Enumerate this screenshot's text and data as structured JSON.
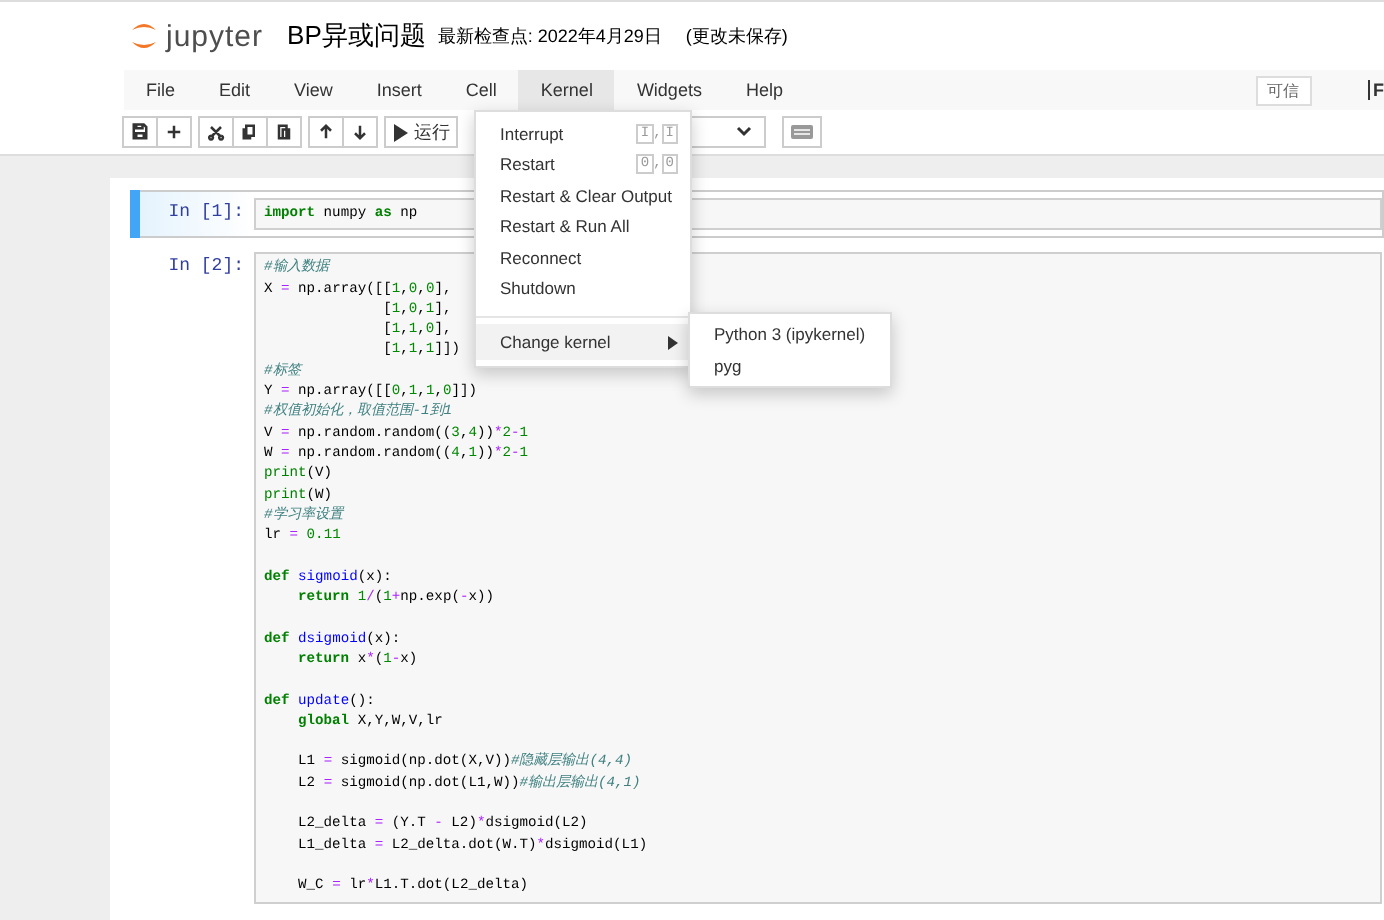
{
  "header": {
    "logo_text": "jupyter",
    "title": "BP异或问题",
    "checkpoint": "最新检查点: 2022年4月29日",
    "unsaved": "(更改未保存)"
  },
  "menubar": {
    "items": [
      {
        "label": "File",
        "selected": false
      },
      {
        "label": "Edit",
        "selected": false
      },
      {
        "label": "View",
        "selected": false
      },
      {
        "label": "Insert",
        "selected": false
      },
      {
        "label": "Cell",
        "selected": false
      },
      {
        "label": "Kernel",
        "selected": true
      },
      {
        "label": "Widgets",
        "selected": false
      },
      {
        "label": "Help",
        "selected": false
      }
    ],
    "trusted": "可信",
    "kernel_indicator": "F"
  },
  "toolbar": {
    "groups": [
      [
        {
          "kind": "save"
        },
        {
          "kind": "add"
        }
      ],
      [
        {
          "kind": "cut"
        },
        {
          "kind": "copy"
        },
        {
          "kind": "paste"
        }
      ],
      [
        {
          "kind": "up"
        },
        {
          "kind": "down"
        }
      ]
    ],
    "run_label": "运行"
  },
  "kernel_menu": {
    "items": [
      {
        "kind": "action",
        "label": "Interrupt",
        "keys": [
          "I",
          "I"
        ],
        "sep": ","
      },
      {
        "kind": "action",
        "label": "Restart",
        "keys": [
          "0",
          "0"
        ],
        "sep": ","
      },
      {
        "kind": "action",
        "label": "Restart & Clear Output"
      },
      {
        "kind": "action",
        "label": "Restart & Run All"
      },
      {
        "kind": "action",
        "label": "Reconnect"
      },
      {
        "kind": "action",
        "label": "Shutdown"
      },
      {
        "kind": "divider"
      },
      {
        "kind": "submenu",
        "label": "Change kernel",
        "expanded": true
      }
    ]
  },
  "kernel_submenu": {
    "items": [
      {
        "label": "Python 3 (ipykernel)"
      },
      {
        "label": "pyg"
      }
    ]
  },
  "cells": [
    {
      "prompt": "In [1]:",
      "selected": true,
      "lines": [
        {
          "kind": "code",
          "tokens": [
            {
              "kind": "kw",
              "text": "import"
            },
            {
              "kind": "p",
              "text": " numpy "
            },
            {
              "kind": "kw",
              "text": "as"
            },
            {
              "kind": "p",
              "text": " np"
            }
          ]
        }
      ]
    },
    {
      "prompt": "In [2]:",
      "selected": false,
      "lines": [
        {
          "kind": "code",
          "tokens": [
            {
              "kind": "cm",
              "text": "#输入数据"
            }
          ]
        },
        {
          "kind": "code",
          "tokens": [
            {
              "kind": "p",
              "text": "X "
            },
            {
              "kind": "op",
              "text": "="
            },
            {
              "kind": "p",
              "text": " np.array([["
            },
            {
              "kind": "num",
              "text": "1"
            },
            {
              "kind": "p",
              "text": ","
            },
            {
              "kind": "num",
              "text": "0"
            },
            {
              "kind": "p",
              "text": ","
            },
            {
              "kind": "num",
              "text": "0"
            },
            {
              "kind": "p",
              "text": "],"
            }
          ]
        },
        {
          "kind": "code",
          "tokens": [
            {
              "kind": "p",
              "text": "              ["
            },
            {
              "kind": "num",
              "text": "1"
            },
            {
              "kind": "p",
              "text": ","
            },
            {
              "kind": "num",
              "text": "0"
            },
            {
              "kind": "p",
              "text": ","
            },
            {
              "kind": "num",
              "text": "1"
            },
            {
              "kind": "p",
              "text": "],"
            }
          ]
        },
        {
          "kind": "code",
          "tokens": [
            {
              "kind": "p",
              "text": "              ["
            },
            {
              "kind": "num",
              "text": "1"
            },
            {
              "kind": "p",
              "text": ","
            },
            {
              "kind": "num",
              "text": "1"
            },
            {
              "kind": "p",
              "text": ","
            },
            {
              "kind": "num",
              "text": "0"
            },
            {
              "kind": "p",
              "text": "],"
            }
          ]
        },
        {
          "kind": "code",
          "tokens": [
            {
              "kind": "p",
              "text": "              ["
            },
            {
              "kind": "num",
              "text": "1"
            },
            {
              "kind": "p",
              "text": ","
            },
            {
              "kind": "num",
              "text": "1"
            },
            {
              "kind": "p",
              "text": ","
            },
            {
              "kind": "num",
              "text": "1"
            },
            {
              "kind": "p",
              "text": "]])"
            }
          ]
        },
        {
          "kind": "code",
          "tokens": [
            {
              "kind": "cm",
              "text": "#标签"
            }
          ]
        },
        {
          "kind": "code",
          "tokens": [
            {
              "kind": "p",
              "text": "Y "
            },
            {
              "kind": "op",
              "text": "="
            },
            {
              "kind": "p",
              "text": " np.array([["
            },
            {
              "kind": "num",
              "text": "0"
            },
            {
              "kind": "p",
              "text": ","
            },
            {
              "kind": "num",
              "text": "1"
            },
            {
              "kind": "p",
              "text": ","
            },
            {
              "kind": "num",
              "text": "1"
            },
            {
              "kind": "p",
              "text": ","
            },
            {
              "kind": "num",
              "text": "0"
            },
            {
              "kind": "p",
              "text": "]])"
            }
          ]
        },
        {
          "kind": "code",
          "tokens": [
            {
              "kind": "cm",
              "text": "#权值初始化，取值范围-1到1"
            }
          ]
        },
        {
          "kind": "code",
          "tokens": [
            {
              "kind": "p",
              "text": "V "
            },
            {
              "kind": "op",
              "text": "="
            },
            {
              "kind": "p",
              "text": " np.random.random(("
            },
            {
              "kind": "num",
              "text": "3"
            },
            {
              "kind": "p",
              "text": ","
            },
            {
              "kind": "num",
              "text": "4"
            },
            {
              "kind": "p",
              "text": "))"
            },
            {
              "kind": "op",
              "text": "*"
            },
            {
              "kind": "num",
              "text": "2"
            },
            {
              "kind": "op",
              "text": "-"
            },
            {
              "kind": "num",
              "text": "1"
            }
          ]
        },
        {
          "kind": "code",
          "tokens": [
            {
              "kind": "p",
              "text": "W "
            },
            {
              "kind": "op",
              "text": "="
            },
            {
              "kind": "p",
              "text": " np.random.random(("
            },
            {
              "kind": "num",
              "text": "4"
            },
            {
              "kind": "p",
              "text": ","
            },
            {
              "kind": "num",
              "text": "1"
            },
            {
              "kind": "p",
              "text": "))"
            },
            {
              "kind": "op",
              "text": "*"
            },
            {
              "kind": "num",
              "text": "2"
            },
            {
              "kind": "op",
              "text": "-"
            },
            {
              "kind": "num",
              "text": "1"
            }
          ]
        },
        {
          "kind": "code",
          "tokens": [
            {
              "kind": "bi",
              "text": "print"
            },
            {
              "kind": "p",
              "text": "(V)"
            }
          ]
        },
        {
          "kind": "code",
          "tokens": [
            {
              "kind": "bi",
              "text": "print"
            },
            {
              "kind": "p",
              "text": "(W)"
            }
          ]
        },
        {
          "kind": "code",
          "tokens": [
            {
              "kind": "cm",
              "text": "#学习率设置"
            }
          ]
        },
        {
          "kind": "code",
          "tokens": [
            {
              "kind": "p",
              "text": "lr "
            },
            {
              "kind": "op",
              "text": "="
            },
            {
              "kind": "num",
              "text": " 0.11"
            }
          ]
        },
        {
          "kind": "blank"
        },
        {
          "kind": "code",
          "tokens": [
            {
              "kind": "kw",
              "text": "def"
            },
            {
              "kind": "fn",
              "text": " sigmoid"
            },
            {
              "kind": "p",
              "text": "(x):"
            }
          ]
        },
        {
          "kind": "code",
          "tokens": [
            {
              "kind": "kw",
              "text": "    return"
            },
            {
              "kind": "num",
              "text": " 1"
            },
            {
              "kind": "op",
              "text": "/"
            },
            {
              "kind": "p",
              "text": "("
            },
            {
              "kind": "num",
              "text": "1"
            },
            {
              "kind": "op",
              "text": "+"
            },
            {
              "kind": "p",
              "text": "np.exp("
            },
            {
              "kind": "op",
              "text": "-"
            },
            {
              "kind": "p",
              "text": "x))"
            }
          ]
        },
        {
          "kind": "blank"
        },
        {
          "kind": "code",
          "tokens": [
            {
              "kind": "kw",
              "text": "def"
            },
            {
              "kind": "fn",
              "text": " dsigmoid"
            },
            {
              "kind": "p",
              "text": "(x):"
            }
          ]
        },
        {
          "kind": "code",
          "tokens": [
            {
              "kind": "kw",
              "text": "    return"
            },
            {
              "kind": "p",
              "text": " x"
            },
            {
              "kind": "op",
              "text": "*"
            },
            {
              "kind": "p",
              "text": "("
            },
            {
              "kind": "num",
              "text": "1"
            },
            {
              "kind": "op",
              "text": "-"
            },
            {
              "kind": "p",
              "text": "x)"
            }
          ]
        },
        {
          "kind": "blank"
        },
        {
          "kind": "code",
          "tokens": [
            {
              "kind": "kw",
              "text": "def"
            },
            {
              "kind": "fn",
              "text": " update"
            },
            {
              "kind": "p",
              "text": "():"
            }
          ]
        },
        {
          "kind": "code",
          "tokens": [
            {
              "kind": "kw",
              "text": "    global"
            },
            {
              "kind": "p",
              "text": " X,Y,W,V,lr"
            }
          ]
        },
        {
          "kind": "blank"
        },
        {
          "kind": "code",
          "tokens": [
            {
              "kind": "p",
              "text": "    L1 "
            },
            {
              "kind": "op",
              "text": "="
            },
            {
              "kind": "p",
              "text": " sigmoid(np.dot(X,V))"
            },
            {
              "kind": "cm",
              "text": "#隐藏层输出(4,4)"
            }
          ]
        },
        {
          "kind": "code",
          "tokens": [
            {
              "kind": "p",
              "text": "    L2 "
            },
            {
              "kind": "op",
              "text": "="
            },
            {
              "kind": "p",
              "text": " sigmoid(np.dot(L1,W))"
            },
            {
              "kind": "cm",
              "text": "#输出层输出(4,1)"
            }
          ]
        },
        {
          "kind": "blank"
        },
        {
          "kind": "code",
          "tokens": [
            {
              "kind": "p",
              "text": "    L2_delta "
            },
            {
              "kind": "op",
              "text": "="
            },
            {
              "kind": "p",
              "text": " (Y.T "
            },
            {
              "kind": "op",
              "text": "-"
            },
            {
              "kind": "p",
              "text": " L2)"
            },
            {
              "kind": "op",
              "text": "*"
            },
            {
              "kind": "p",
              "text": "dsigmoid(L2)"
            }
          ]
        },
        {
          "kind": "code",
          "tokens": [
            {
              "kind": "p",
              "text": "    L1_delta "
            },
            {
              "kind": "op",
              "text": "="
            },
            {
              "kind": "p",
              "text": " L2_delta.dot(W.T)"
            },
            {
              "kind": "op",
              "text": "*"
            },
            {
              "kind": "p",
              "text": "dsigmoid(L1)"
            }
          ]
        },
        {
          "kind": "blank"
        },
        {
          "kind": "code",
          "tokens": [
            {
              "kind": "p",
              "text": "    W_C "
            },
            {
              "kind": "op",
              "text": "="
            },
            {
              "kind": "p",
              "text": " lr"
            },
            {
              "kind": "op",
              "text": "*"
            },
            {
              "kind": "p",
              "text": "L1.T.dot(L2_delta)"
            }
          ]
        }
      ]
    }
  ]
}
